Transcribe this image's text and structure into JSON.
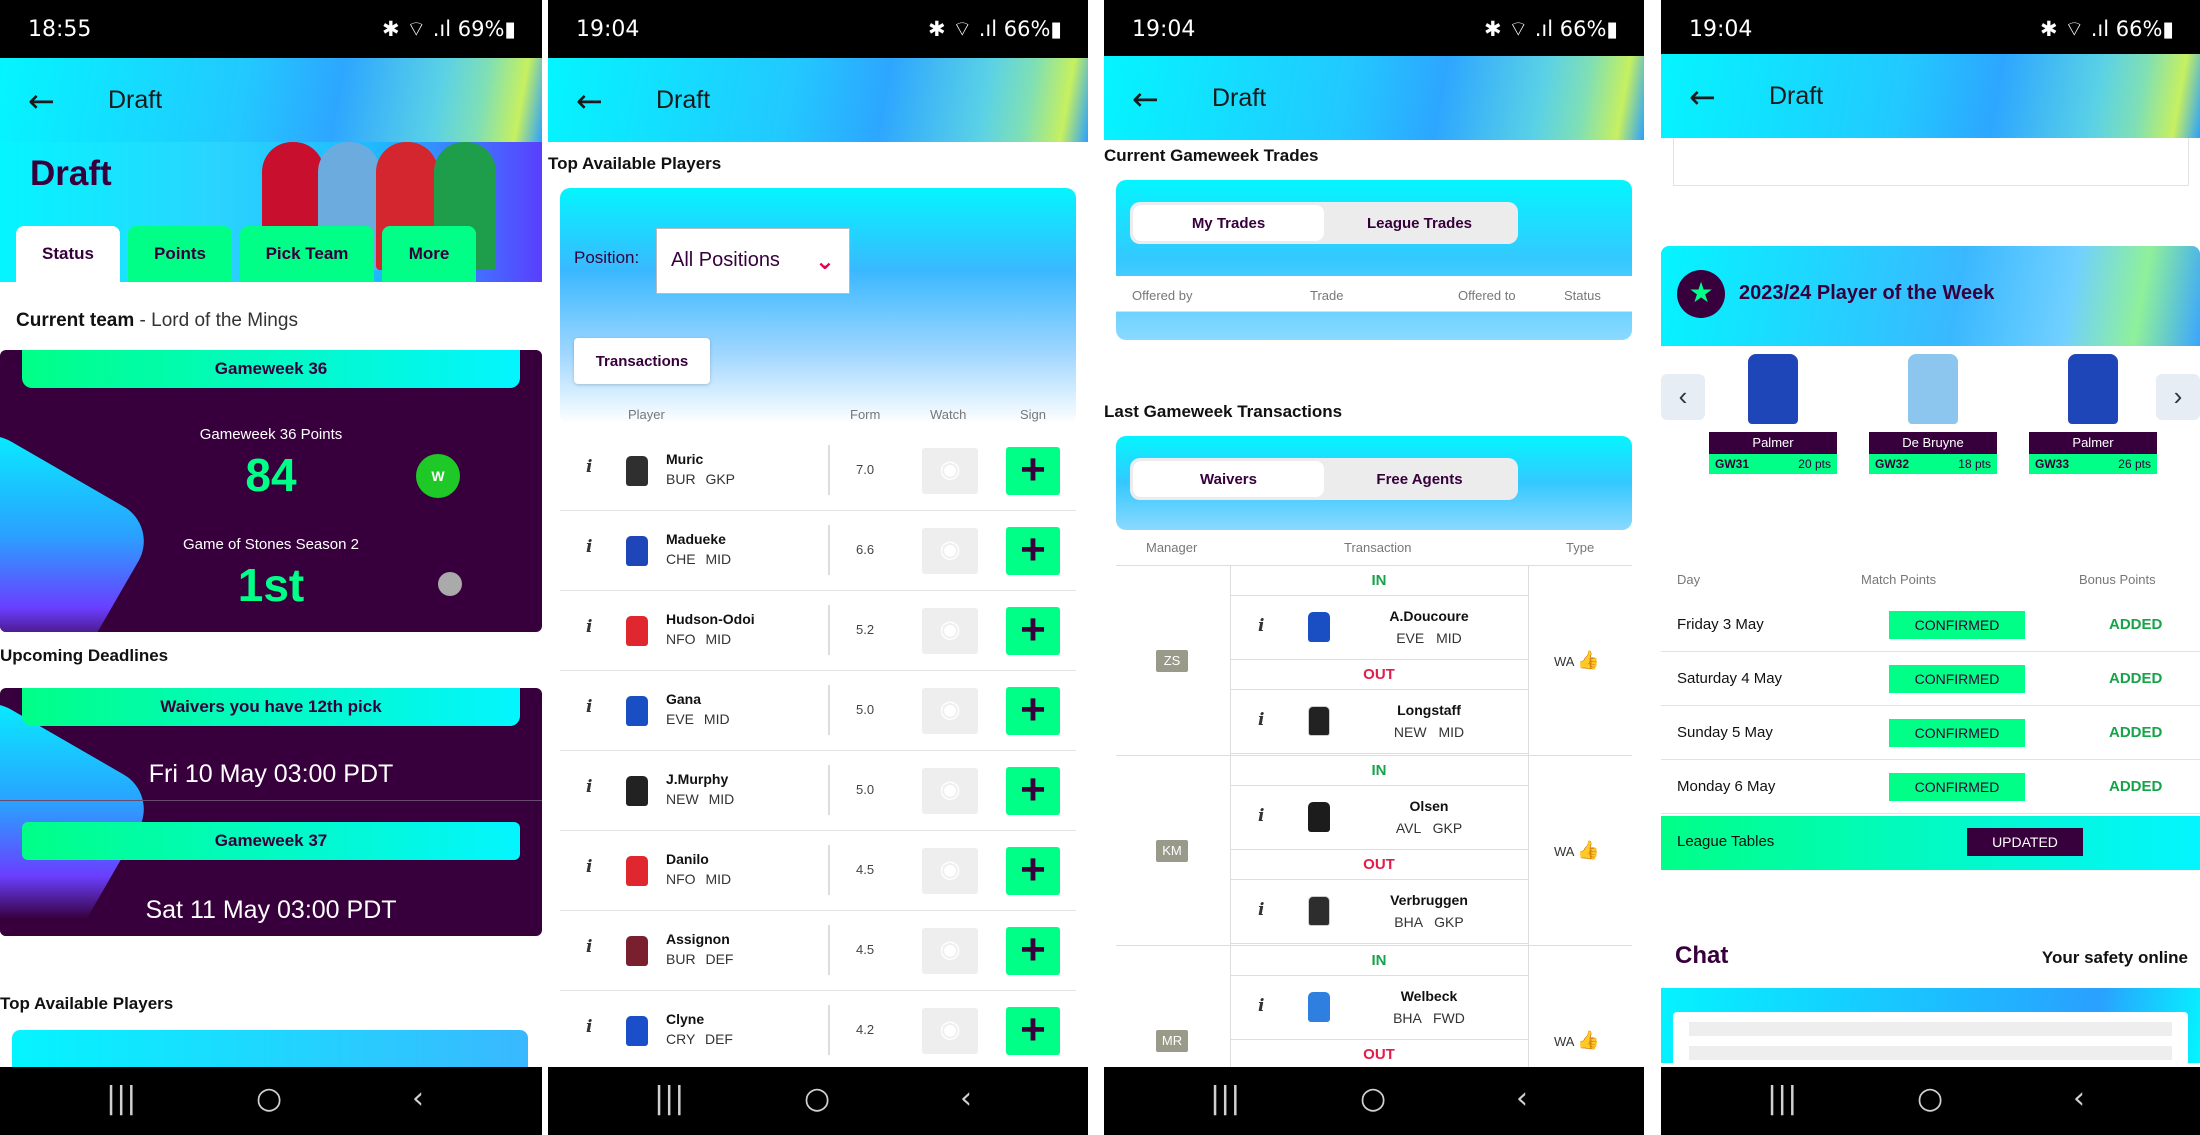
{
  "status_bars": [
    {
      "time": "18:55",
      "right": "✱ ⌔ .ıl 69%▮"
    },
    {
      "time": "19:04",
      "right": "✱ ⌔ .ıl 66%▮"
    },
    {
      "time": "19:04",
      "right": "✱ ⌔ .ıl 66%▮"
    },
    {
      "time": "19:04",
      "right": "✱ ⌔ .ıl 66%▮"
    }
  ],
  "header": {
    "back": "←",
    "title": "Draft"
  },
  "nav": {
    "recents": "|||",
    "home": "○",
    "back": "‹"
  },
  "panel1": {
    "banner_title": "Draft",
    "tabs": [
      "Status",
      "Points",
      "Pick Team",
      "More"
    ],
    "current_team_label": "Current team",
    "current_team_name": " - Lord of the Mings",
    "gameweek_pill": "Gameweek 36",
    "gw_points_label": "Gameweek 36 Points",
    "gw_points": "84",
    "result_badge": "W",
    "league_name": "Game of Stones Season 2",
    "league_rank": "1st",
    "upcoming_title": "Upcoming Deadlines",
    "waivers_pill": "Waivers you have 12th pick",
    "waivers_date": "Fri 10 May 03:00 PDT",
    "gw37_pill": "Gameweek 37",
    "gw37_date": "Sat 11 May 03:00 PDT",
    "top_players_title": "Top Available Players"
  },
  "panel2": {
    "section_title": "Top Available Players",
    "position_label": "Position:",
    "position_value": "All Positions",
    "transactions_button": "Transactions",
    "columns": [
      "Player",
      "Form",
      "Watch",
      "Sign"
    ],
    "players": [
      {
        "name": "Muric",
        "team": "BUR",
        "pos": "GKP",
        "form": "7.0",
        "kit": "#2f2f2f"
      },
      {
        "name": "Madueke",
        "team": "CHE",
        "pos": "MID",
        "form": "6.6",
        "kit": "#1f46b8"
      },
      {
        "name": "Hudson-Odoi",
        "team": "NFO",
        "pos": "MID",
        "form": "5.2",
        "kit": "#e0262e"
      },
      {
        "name": "Gana",
        "team": "EVE",
        "pos": "MID",
        "form": "5.0",
        "kit": "#1a4fc4"
      },
      {
        "name": "J.Murphy",
        "team": "NEW",
        "pos": "MID",
        "form": "5.0",
        "kit": "#222222"
      },
      {
        "name": "Danilo",
        "team": "NFO",
        "pos": "MID",
        "form": "4.5",
        "kit": "#e0262e"
      },
      {
        "name": "Assignon",
        "team": "BUR",
        "pos": "DEF",
        "form": "4.5",
        "kit": "#7a1f2e"
      },
      {
        "name": "Clyne",
        "team": "CRY",
        "pos": "DEF",
        "form": "4.2",
        "kit": "#1b4ec9"
      }
    ],
    "info_icon": "i",
    "eye_icon": "◉",
    "sign_icon": "+"
  },
  "panel3": {
    "trades_title": "Current Gameweek Trades",
    "trade_tabs": [
      "My Trades",
      "League Trades"
    ],
    "trade_columns": [
      "Offered by",
      "Trade",
      "Offered to",
      "Status"
    ],
    "last_title": "Last Gameweek Transactions",
    "tx_tabs": [
      "Waivers",
      "Free Agents"
    ],
    "tx_columns": [
      "Manager",
      "Transaction",
      "Type"
    ],
    "in_label": "IN",
    "out_label": "OUT",
    "transactions": [
      {
        "manager": "ZS",
        "type": "WA",
        "in": {
          "name": "A.Doucoure",
          "team": "EVE",
          "pos": "MID",
          "kit": "#1a4fc4"
        },
        "out": {
          "name": "Longstaff",
          "team": "NEW",
          "pos": "MID",
          "kit": "#222222"
        }
      },
      {
        "manager": "KM",
        "type": "WA",
        "in": {
          "name": "Olsen",
          "team": "AVL",
          "pos": "GKP",
          "kit": "#1c1c1c"
        },
        "out": {
          "name": "Verbruggen",
          "team": "BHA",
          "pos": "GKP",
          "kit": "#2d2d2d"
        }
      },
      {
        "manager": "MR",
        "type": "WA",
        "in": {
          "name": "Welbeck",
          "team": "BHA",
          "pos": "FWD",
          "kit": "#2f7fe0"
        },
        "out": {
          "name": "",
          "team": "",
          "pos": "",
          "kit": "#ffffff"
        }
      }
    ],
    "thumb_icon": "👍"
  },
  "panel4": {
    "potw_title": "2023/24 Player of the Week",
    "potw": [
      {
        "name": "Palmer",
        "gw": "GW31",
        "pts": "20 pts",
        "kit": "#1f46b8"
      },
      {
        "name": "De Bruyne",
        "gw": "GW32",
        "pts": "18 pts",
        "kit": "#8cc6ee"
      },
      {
        "name": "Palmer",
        "gw": "GW33",
        "pts": "26 pts",
        "kit": "#1f46b8"
      }
    ],
    "prev_icon": "‹",
    "next_icon": "›",
    "columns": [
      "Day",
      "Match Points",
      "Bonus Points"
    ],
    "days": [
      {
        "day": "Friday 3 May",
        "match": "CONFIRMED",
        "bonus": "ADDED"
      },
      {
        "day": "Saturday 4 May",
        "match": "CONFIRMED",
        "bonus": "ADDED"
      },
      {
        "day": "Sunday 5 May",
        "match": "CONFIRMED",
        "bonus": "ADDED"
      },
      {
        "day": "Monday 6 May",
        "match": "CONFIRMED",
        "bonus": "ADDED"
      }
    ],
    "league_tables_label": "League Tables",
    "league_tables_status": "UPDATED",
    "chat_title": "Chat",
    "chat_link": "Your safety online"
  }
}
